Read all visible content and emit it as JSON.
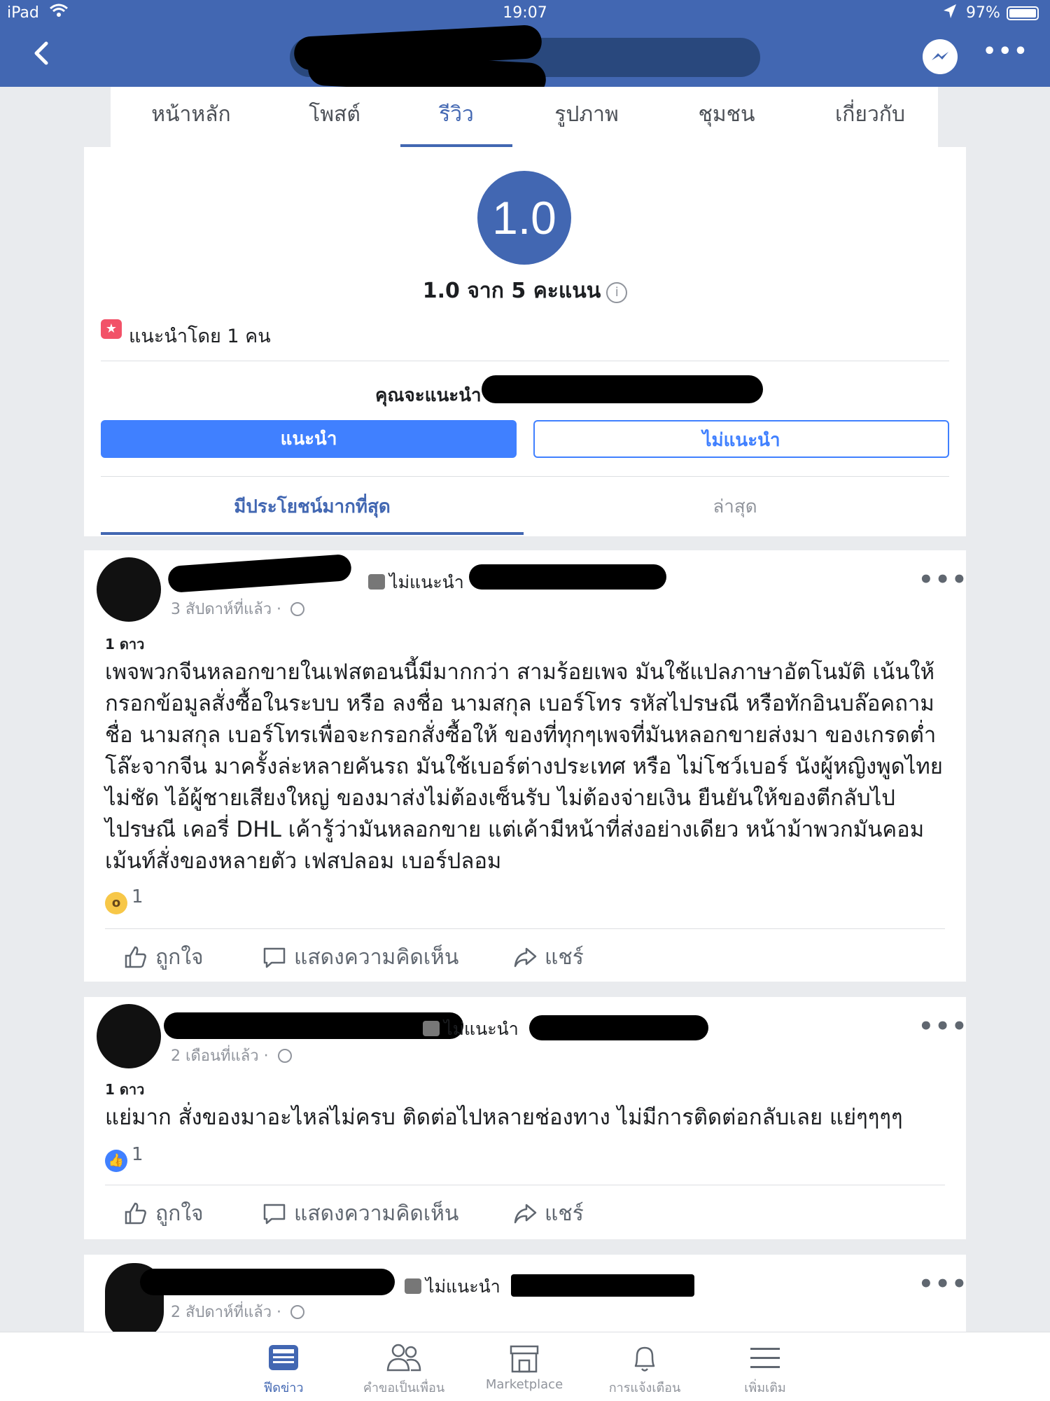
{
  "status_bar": {
    "carrier": "iPad",
    "time": "19:07",
    "battery": "97%"
  },
  "tabs": [
    {
      "label": "หน้าหลัก"
    },
    {
      "label": "โพสต์"
    },
    {
      "label": "รีวิว"
    },
    {
      "label": "รูปภาพ"
    },
    {
      "label": "ชุมชน"
    },
    {
      "label": "เกี่ยวกับ"
    }
  ],
  "rating": {
    "score": "1.0",
    "summary": "1.0 จาก 5 คะแนน",
    "info_icon": "i",
    "recommended_by": "แนะนำโดย 1 คน",
    "question": "คุณจะแนะนำ",
    "recommend_button": "แนะนำ",
    "not_recommend_button": "ไม่แนะนำ",
    "sort_tabs": [
      "มีประโยชน์มากที่สุด",
      "ล่าสุด"
    ]
  },
  "posts": [
    {
      "recommend_tag": "ไม่แนะนำ",
      "time": "3 สัปดาห์ที่แล้ว",
      "stars_label": "1 ดาว",
      "body": "เพจพวกจีนหลอกขายในเฟสตอนนี้มีมากกว่า สามร้อยเพจ มันใช้แปลภาษาอัตโนมัติ เน้นให้กรอกข้อมูลสั่งซื้อในระบบ หรือ ลงชื่อ นามสกุล เบอร์โทร รหัสไปรษณี หรือทักอินบล๊อคถาม ชื่อ นามสกุล เบอร์โทรเพื่อจะกรอกสั่งซื้อให้ ของที่ทุกๆเพจที่มันหลอกขายส่งมา ของเกรดต่ำโล๊ะจากจีน มาครั้งล่ะหลายคันรถ มันใช้เบอร์ต่างประเทศ หรือ ไม่โชว์เบอร์ นังผู้หญิงพูดไทยไม่ชัด ไอ้ผู้ชายเสียงใหญ่ ของมาส่งไม่ต้องเซ็นรับ ไม่ต้องจ่ายเงิน ยืนยันให้ของตีกลับไป ไปรษณี เคอรี่ DHL เค้ารู้ว่ามันหลอกขาย แต่เค้ามีหน้าที่ส่งอย่างเดียว หน้าม้าพวกมันคอมเม้นท์สั่งของหลายตัว เฟสปลอม เบอร์ปลอม",
      "reaction_count": "1",
      "actions": [
        "ถูกใจ",
        "แสดงความคิดเห็น",
        "แชร์"
      ]
    },
    {
      "recommend_tag": "ไม่แนะนำ",
      "time": "2 เดือนที่แล้ว",
      "stars_label": "1 ดาว",
      "body": "แย่มาก สั่งของมาอะไหล่ไม่ครบ ติดต่อไปหลายช่องทาง ไม่มีการติดต่อกลับเลย แย่ๆๆๆๆ",
      "reaction_count": "1",
      "actions": [
        "ถูกใจ",
        "แสดงความคิดเห็น",
        "แชร์"
      ]
    },
    {
      "recommend_tag": "ไม่แนะนำ",
      "time": "2 สัปดาห์ที่แล้ว"
    }
  ],
  "bottom_nav": [
    {
      "label": "ฟีดข่าว",
      "icon": "news-feed-icon"
    },
    {
      "label": "คำขอเป็นเพื่อน",
      "icon": "friends-icon"
    },
    {
      "label": "Marketplace",
      "icon": "marketplace-icon"
    },
    {
      "label": "การแจ้งเตือน",
      "icon": "bell-icon"
    },
    {
      "label": "เพิ่มเติม",
      "icon": "menu-icon"
    }
  ],
  "colors": {
    "facebook_blue": "#4267b2",
    "button_blue": "#4080ff",
    "background": "#e9ebee"
  }
}
